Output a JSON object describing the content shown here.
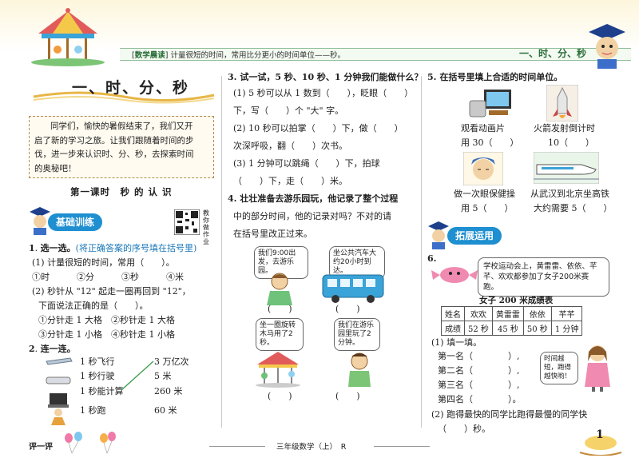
{
  "header": {
    "tag_label": "数学晨读",
    "tag_text": "计量很短的时间，常用比分更小的时间单位——秒。",
    "unit_title": "一、时、分、秒"
  },
  "left": {
    "title": "一、时、分、秒",
    "intro": [
      "同学们，愉快的暑假结束了，我们又开",
      "启了新的学习之旅。让我们跟随着时间的步",
      "伐，进一步来认识时、分、秒，去探索时间",
      "的奥秘吧！"
    ],
    "lesson_title": "第一课时　秒 的 认 识",
    "section_basic": "基础训练",
    "qr_caption": "教你做作业",
    "q1": {
      "num": "1",
      "label": "选一选。",
      "hint": "(将正确答案的序号填在括号里)",
      "sub1": "(1) 计量很短的时间，常用（　　）。",
      "sub1_opts": [
        "①时",
        "②分",
        "③秒",
        "④米"
      ],
      "sub2a": "(2) 秒针从 \"12\" 起走一圈再回到 \"12\"，",
      "sub2b": "下面说法正确的是（　　）。",
      "sub2_opt1": "①分针走 1 大格　②秒针走 1 大格",
      "sub2_opt2": "③分针走 1 小格　④秒针走 1 小格"
    },
    "q2": {
      "num": "2",
      "label": "连一连。",
      "left_items": [
        "1 秒飞行",
        "1 秒行驶",
        "1 秒能计算",
        "1 秒跑"
      ],
      "right_items": [
        "3 万亿次",
        "5 米",
        "260 米",
        "60 米"
      ]
    },
    "footer_label": "评一评"
  },
  "middle": {
    "q3": {
      "title": "3. 试一试，5 秒、10 秒、1 分钟我们能做什么？",
      "l1": "(1) 5 秒可以从 1 数到（　　），眨眼（　　）",
      "l2": "下，写（　　）个 \"大\" 字。",
      "l3": "(2) 10 秒可以拍掌（　　）下，做（　　）",
      "l4": "次深呼吸，翻（　　）次书。",
      "l5": "(3) 1 分钟可以跳绳（　　）下，拍球",
      "l6": "（　　）下，走（　　）米。"
    },
    "q4": {
      "title1": "4. 壮壮准备去游乐园玩，他记录了整个过程",
      "title2": "中的部分时间，他的记录对吗？不对的请",
      "title3": "在括号里改正过来。",
      "bubble1": "我们9:00出发，去游乐园。",
      "bubble2": "坐公共汽车大约20小时到达。",
      "bubble3": "坐一圈旋转木马用了2秒。",
      "bubble4": "我们在游乐园里玩了2分钟。",
      "paren": "(　　)"
    },
    "footer_book": "三年级数学（上）",
    "footer_r": "R"
  },
  "right": {
    "q5_title": "5. 在括号里填上合适的时间单位。",
    "q5_items": [
      {
        "a": "观看动画片",
        "b": "用 30（　　）"
      },
      {
        "a": "火箭发射倒计时",
        "b": "10（　　）"
      },
      {
        "a": "做一次眼保健操",
        "b": "用 5（　　）"
      },
      {
        "a": "从武汉到北京坐高铁",
        "b": "大约需要 5（　　）"
      }
    ],
    "section_ext": "拓展运用",
    "q6_num": "6.",
    "q6_bubble": "学校运动会上，黄雷雷、依依、芊芊、欢欢都参加了女子200米赛跑。",
    "table_title": "女子 200 米成绩表",
    "table_header": [
      "姓名",
      "欢欢",
      "黄雷雷",
      "依依",
      "芊芊"
    ],
    "table_row": [
      "成绩",
      "52 秒",
      "45 秒",
      "50 秒",
      "1 分钟"
    ],
    "fill_label": "(1) 填一填。",
    "ranks": [
      "第一名（　　　　）,",
      "第二名（　　　　）,",
      "第三名（　　　　）,",
      "第四名（　　　　）。"
    ],
    "girl_bubble": "时间越短，跑得越快哟！",
    "q6_2a": "(2) 跑得最快的同学比跑得最慢的同学快",
    "q6_2b": "（　　）秒。",
    "page_number": "1"
  },
  "colors": {
    "accent_blue": "#1e8fd0",
    "hint_blue": "#1a78b8",
    "title_red": "#c8282a"
  }
}
